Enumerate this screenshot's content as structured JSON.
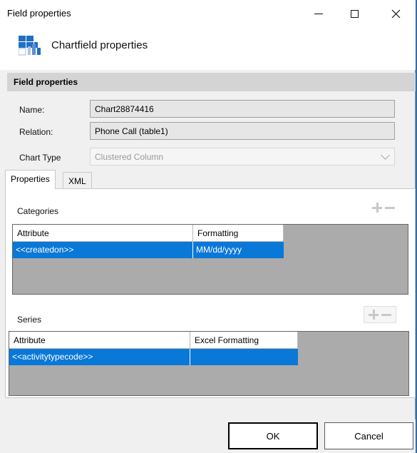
{
  "window": {
    "title": "Field properties"
  },
  "header": {
    "title": "Chartfield properties"
  },
  "section": {
    "title": "Field properties"
  },
  "form": {
    "name_label": "Name:",
    "name_value": "Chart28874416",
    "relation_label": "Relation:",
    "relation_value": "Phone Call (table1)",
    "chart_type_label": "Chart Type",
    "chart_type_value": "Clustered Column"
  },
  "tabs": [
    {
      "label": "Properties"
    },
    {
      "label": "XML"
    }
  ],
  "categories": {
    "label": "Categories",
    "columns": [
      "Attribute",
      "Formatting"
    ],
    "rows": [
      [
        "<<createdon>>",
        "MM/dd/yyyy"
      ]
    ]
  },
  "series": {
    "label": "Series",
    "columns": [
      "Attribute",
      "Excel Formatting"
    ],
    "rows": [
      [
        "<<activitytypecode>>",
        ""
      ]
    ]
  },
  "buttons": {
    "ok": "OK",
    "cancel": "Cancel"
  },
  "icons": {
    "logo": "chart-logo-icon",
    "add": "plus-icon",
    "remove": "minus-icon"
  },
  "colors": {
    "selection": "#0a78d7",
    "grid_background": "#ababab",
    "logo_blue": "#1f6fc5"
  }
}
